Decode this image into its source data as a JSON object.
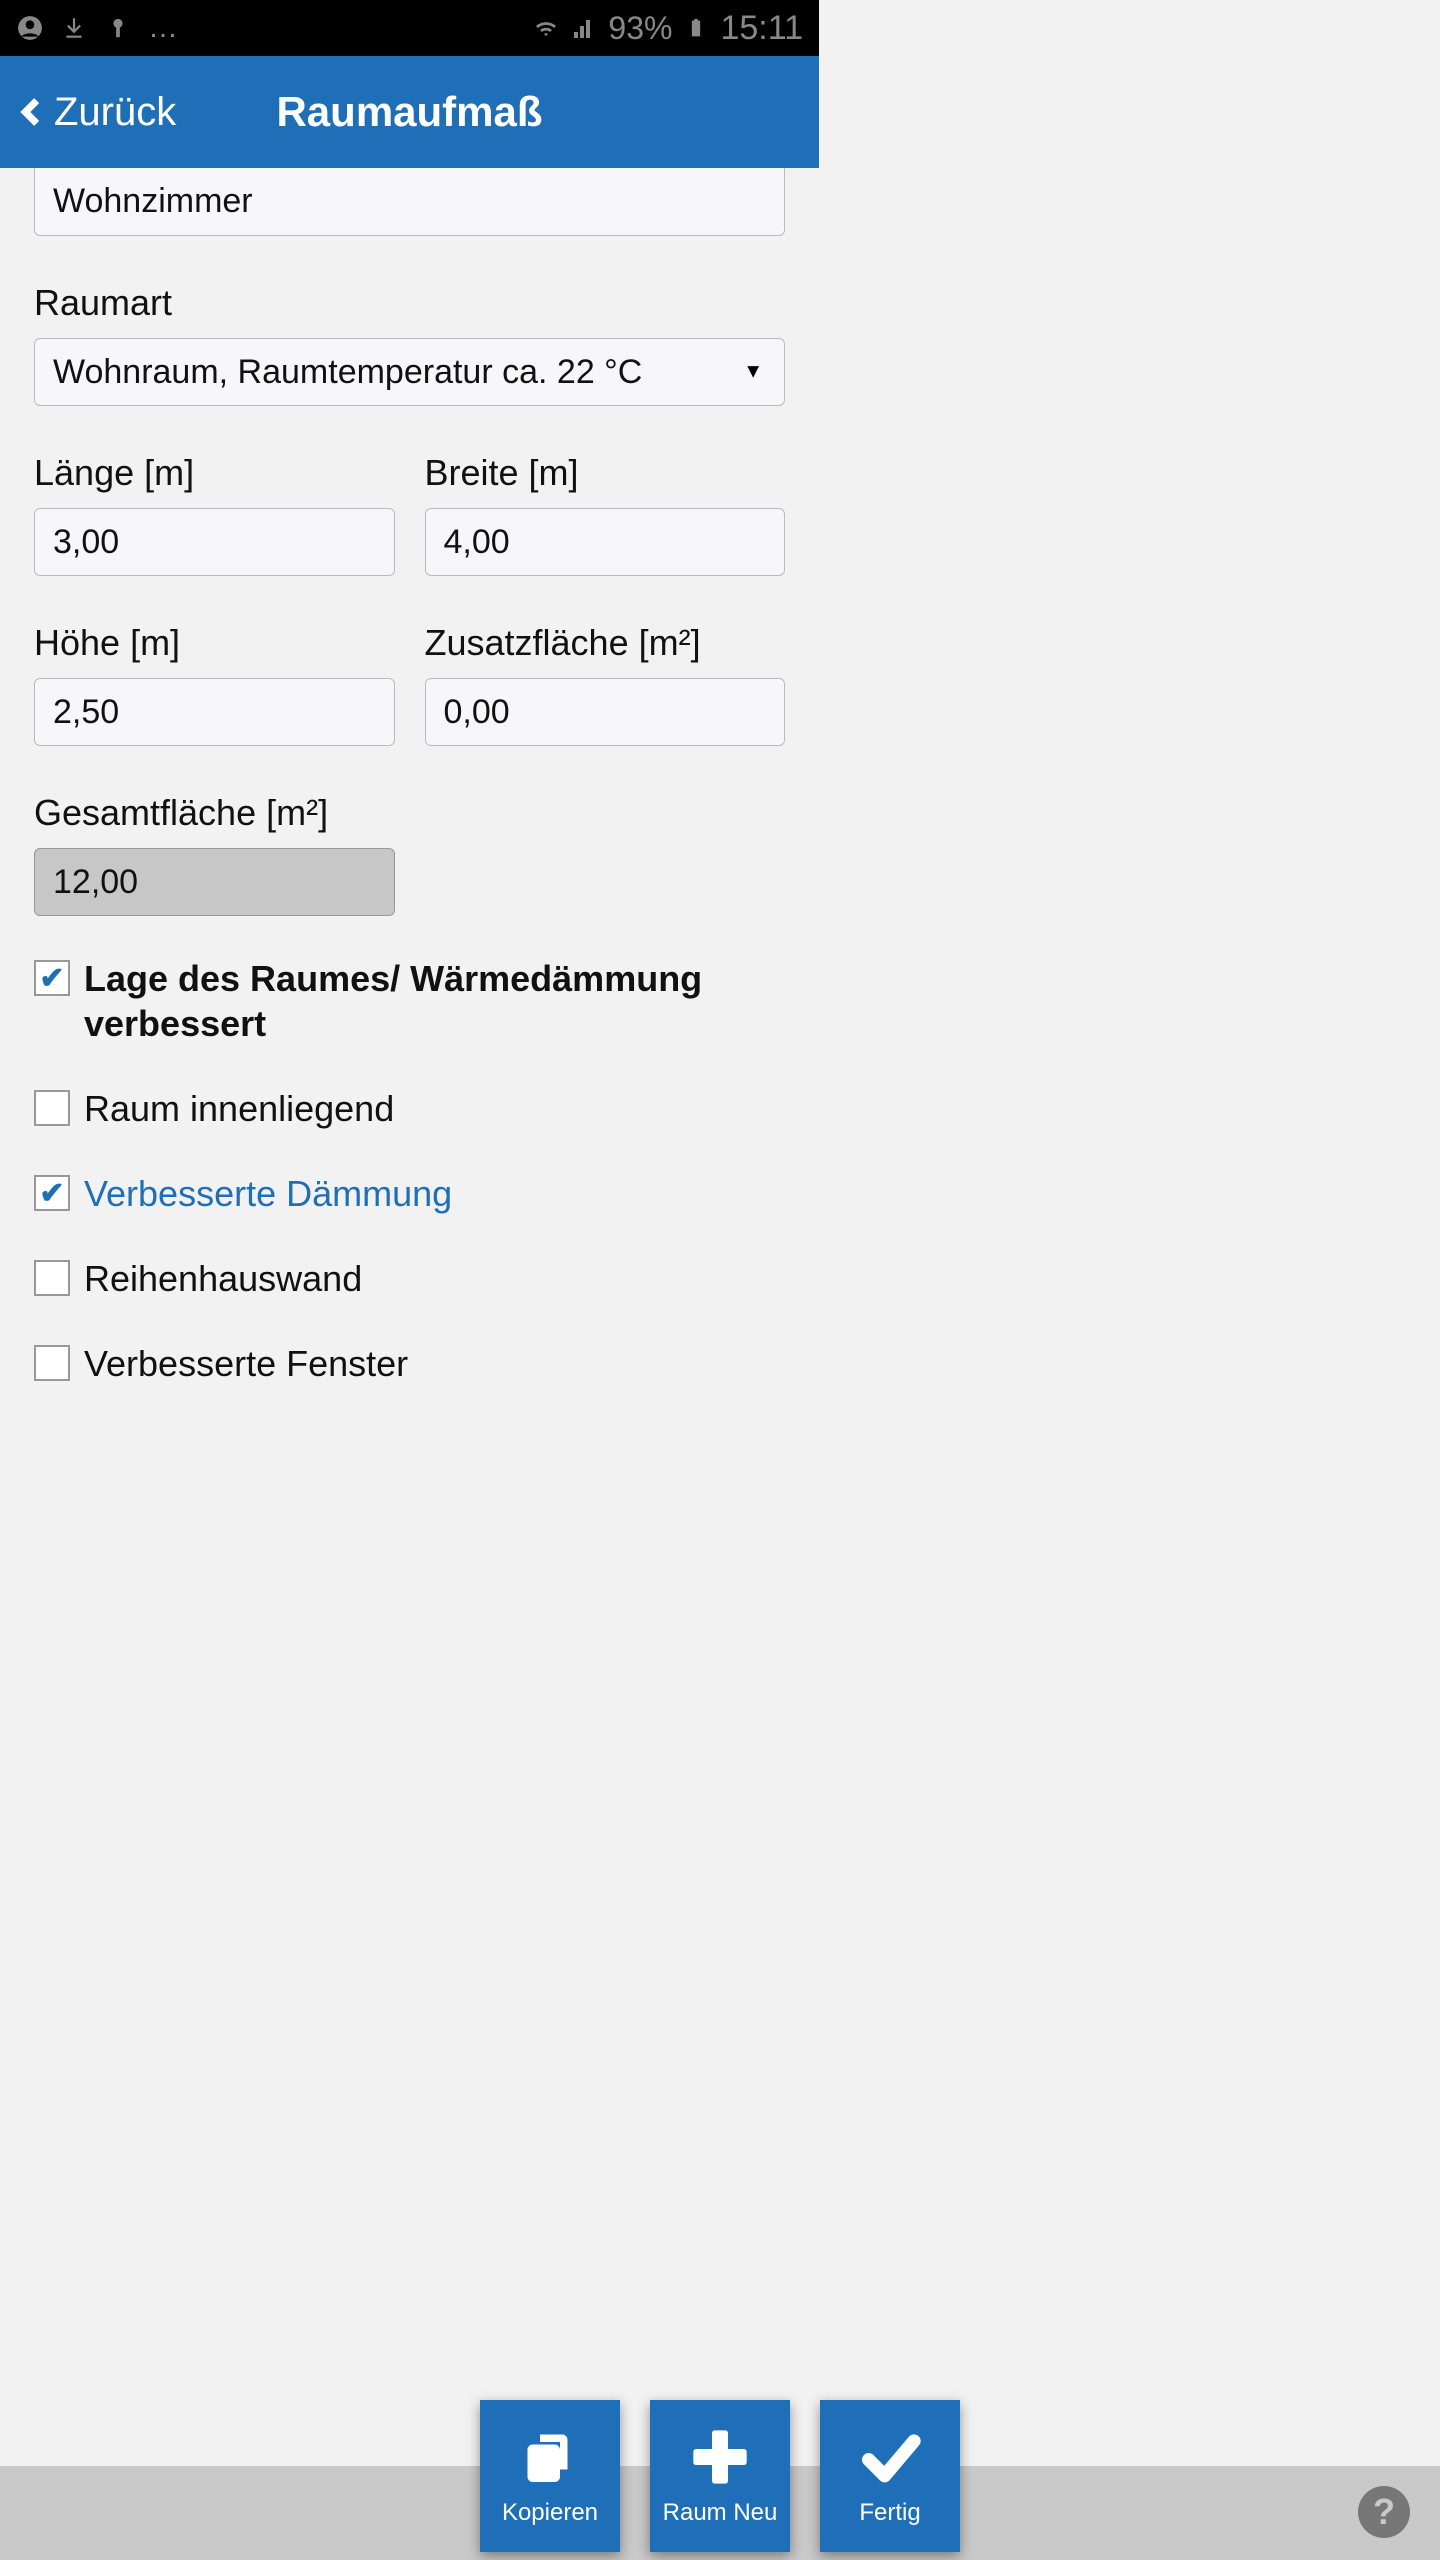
{
  "status": {
    "battery": "93%",
    "time": "15:11"
  },
  "header": {
    "back": "Zurück",
    "title": "Raumaufmaß"
  },
  "room_name": "Wohnzimmer",
  "raumart": {
    "label": "Raumart",
    "value": "Wohnraum, Raumtemperatur ca. 22 °C"
  },
  "laenge": {
    "label": "Länge [m]",
    "value": "3,00"
  },
  "breite": {
    "label": "Breite [m]",
    "value": "4,00"
  },
  "hoehe": {
    "label": "Höhe [m]",
    "value": "2,50"
  },
  "zusatz": {
    "label": "Zusatzfläche [m²]",
    "value": "0,00"
  },
  "gesamt": {
    "label": "Gesamtfläche [m²]",
    "value": "12,00"
  },
  "checks": {
    "lage": {
      "label": "Lage des Raumes/ Wärmedämmung verbessert",
      "checked": true
    },
    "innen": {
      "label": "Raum innenliegend",
      "checked": false
    },
    "daemm": {
      "label": "Verbesserte Dämmung",
      "checked": true
    },
    "reihe": {
      "label": "Reihenhauswand",
      "checked": false
    },
    "fenster": {
      "label": "Verbesserte Fenster",
      "checked": false
    }
  },
  "actions": {
    "copy": "Kopieren",
    "new": "Raum Neu",
    "done": "Fertig"
  }
}
